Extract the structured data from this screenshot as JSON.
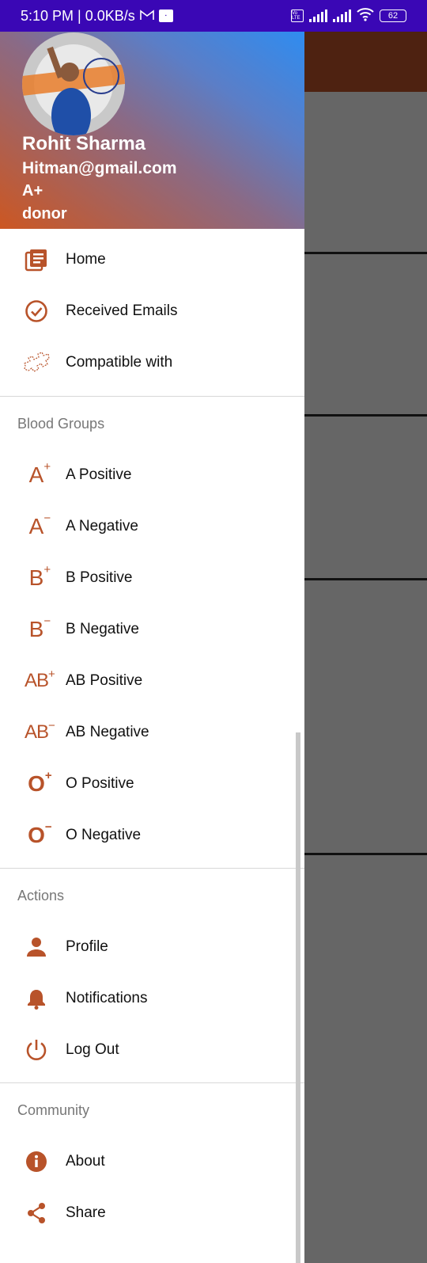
{
  "status_bar": {
    "time_speed": "5:10 PM | 0.0KB/s",
    "battery": "62",
    "volte": "Vo LTE"
  },
  "drawer_header": {
    "name": "Rohit Sharma",
    "email": "Hitman@gmail.com",
    "blood_group": "A+",
    "role": "donor"
  },
  "menu": {
    "home": "Home",
    "received_emails": "Received Emails",
    "compatible_with": "Compatible with"
  },
  "blood_groups": {
    "section_title": "Blood Groups",
    "items": [
      {
        "label": "A Positive",
        "glyph": "A",
        "sign": "+"
      },
      {
        "label": "A Negative",
        "glyph": "A",
        "sign": "−"
      },
      {
        "label": "B Positive",
        "glyph": "B",
        "sign": "+"
      },
      {
        "label": "B Negative",
        "glyph": "B",
        "sign": "−"
      },
      {
        "label": "AB Positive",
        "glyph": "AB",
        "sign": "+"
      },
      {
        "label": "AB Negative",
        "glyph": "AB",
        "sign": "−"
      },
      {
        "label": "O Positive",
        "glyph": "O",
        "sign": "+"
      },
      {
        "label": "O Negative",
        "glyph": "O",
        "sign": "−"
      }
    ]
  },
  "actions": {
    "section_title": "Actions",
    "profile": "Profile",
    "notifications": "Notifications",
    "logout": "Log Out"
  },
  "community": {
    "section_title": "Community",
    "about": "About",
    "share": "Share"
  },
  "colors": {
    "status_bar": "#3a07b5",
    "icon_accent": "#b8532a",
    "scrim": "#666666",
    "toolbar": "#4e2211"
  }
}
